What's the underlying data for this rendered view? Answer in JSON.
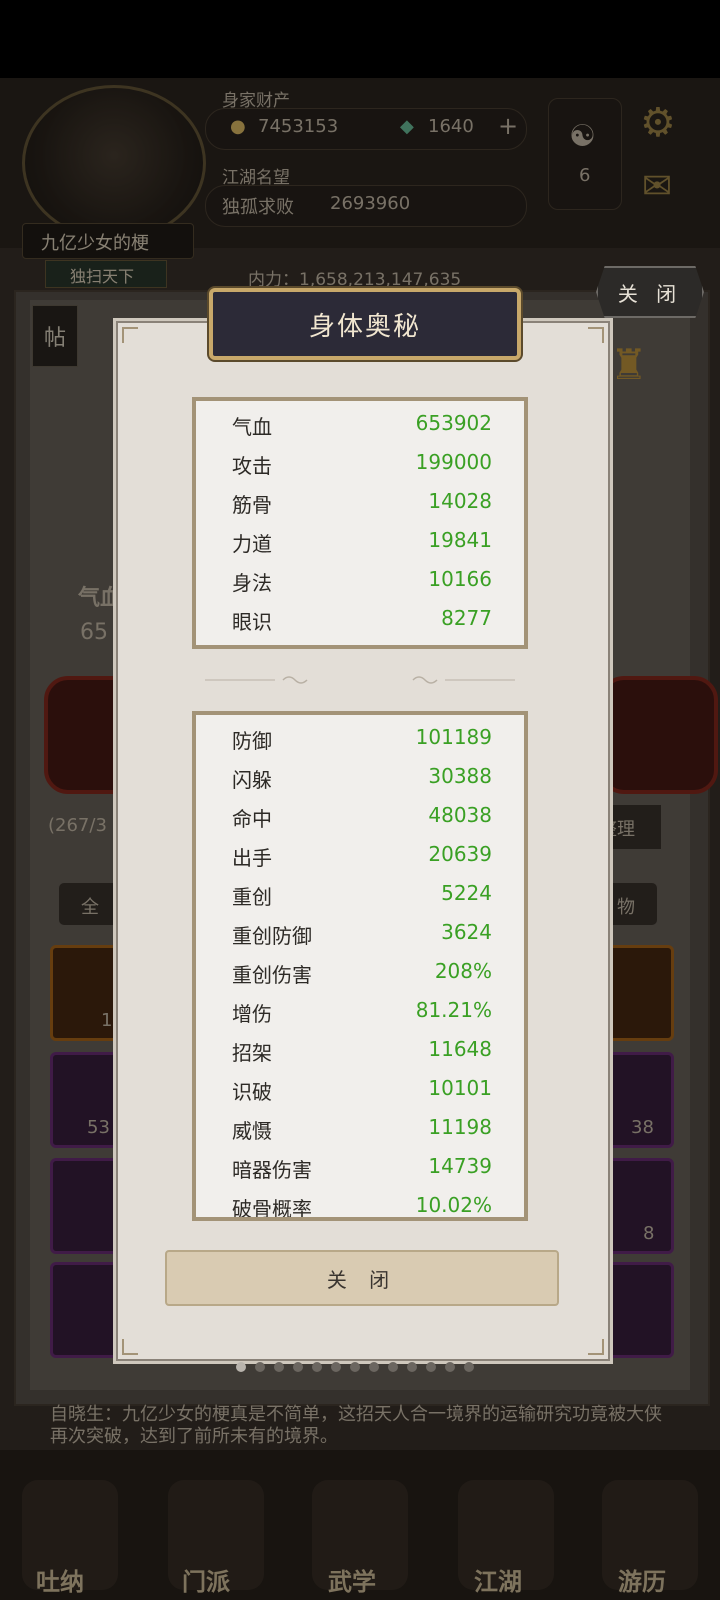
{
  "background": {
    "resource_label": "身家财产",
    "silver": "7453153",
    "jade": "1640",
    "reputation_label": "江湖名望",
    "rank_title": "独孤求败",
    "reputation_value": "2693960",
    "player_name": "九亿少女的梗",
    "title_tag": "独扫天下",
    "inner_power": "内力：1,658,213,147,635",
    "taiji_level": "6",
    "top_close": "关 闭",
    "post_tab": "帖",
    "vitality_short": "气血",
    "vitality_partial": "65",
    "bag_count": "(267/3",
    "organize": "整理",
    "filter_all": "全",
    "filter_item": "物",
    "slot_counts": [
      "16",
      "53",
      "38",
      "8"
    ],
    "narration": "自晓生：九亿少女的梗真是不简单，这招天人合一境界的运输研究功竟被大侠再次突破，达到了前所未有的境界。",
    "nav": [
      "吐纳",
      "门派",
      "武学",
      "江湖",
      "游历"
    ]
  },
  "dialog": {
    "title": "身体奥秘",
    "close_label": "关 闭",
    "basic_stats": [
      {
        "name": "气血",
        "value": "653902"
      },
      {
        "name": "攻击",
        "value": "199000"
      },
      {
        "name": "筋骨",
        "value": "14028"
      },
      {
        "name": "力道",
        "value": "19841"
      },
      {
        "name": "身法",
        "value": "10166"
      },
      {
        "name": "眼识",
        "value": "8277"
      }
    ],
    "advanced_stats": [
      {
        "name": "防御",
        "value": "101189"
      },
      {
        "name": "闪躲",
        "value": "30388"
      },
      {
        "name": "命中",
        "value": "48038"
      },
      {
        "name": "出手",
        "value": "20639"
      },
      {
        "name": "重创",
        "value": "5224"
      },
      {
        "name": "重创防御",
        "value": "3624"
      },
      {
        "name": "重创伤害",
        "value": "208%"
      },
      {
        "name": "增伤",
        "value": "81.21%"
      },
      {
        "name": "招架",
        "value": "11648"
      },
      {
        "name": "识破",
        "value": "10101"
      },
      {
        "name": "威慑",
        "value": "11198"
      },
      {
        "name": "暗器伤害",
        "value": "14739"
      },
      {
        "name": "破骨概率",
        "value": "10.02%"
      }
    ],
    "page_dots": 13,
    "active_dot": 0
  },
  "colors": {
    "stat_value": "#3aa024",
    "title_bg": "#2c2a37",
    "gold_border": "#c8a86a"
  }
}
